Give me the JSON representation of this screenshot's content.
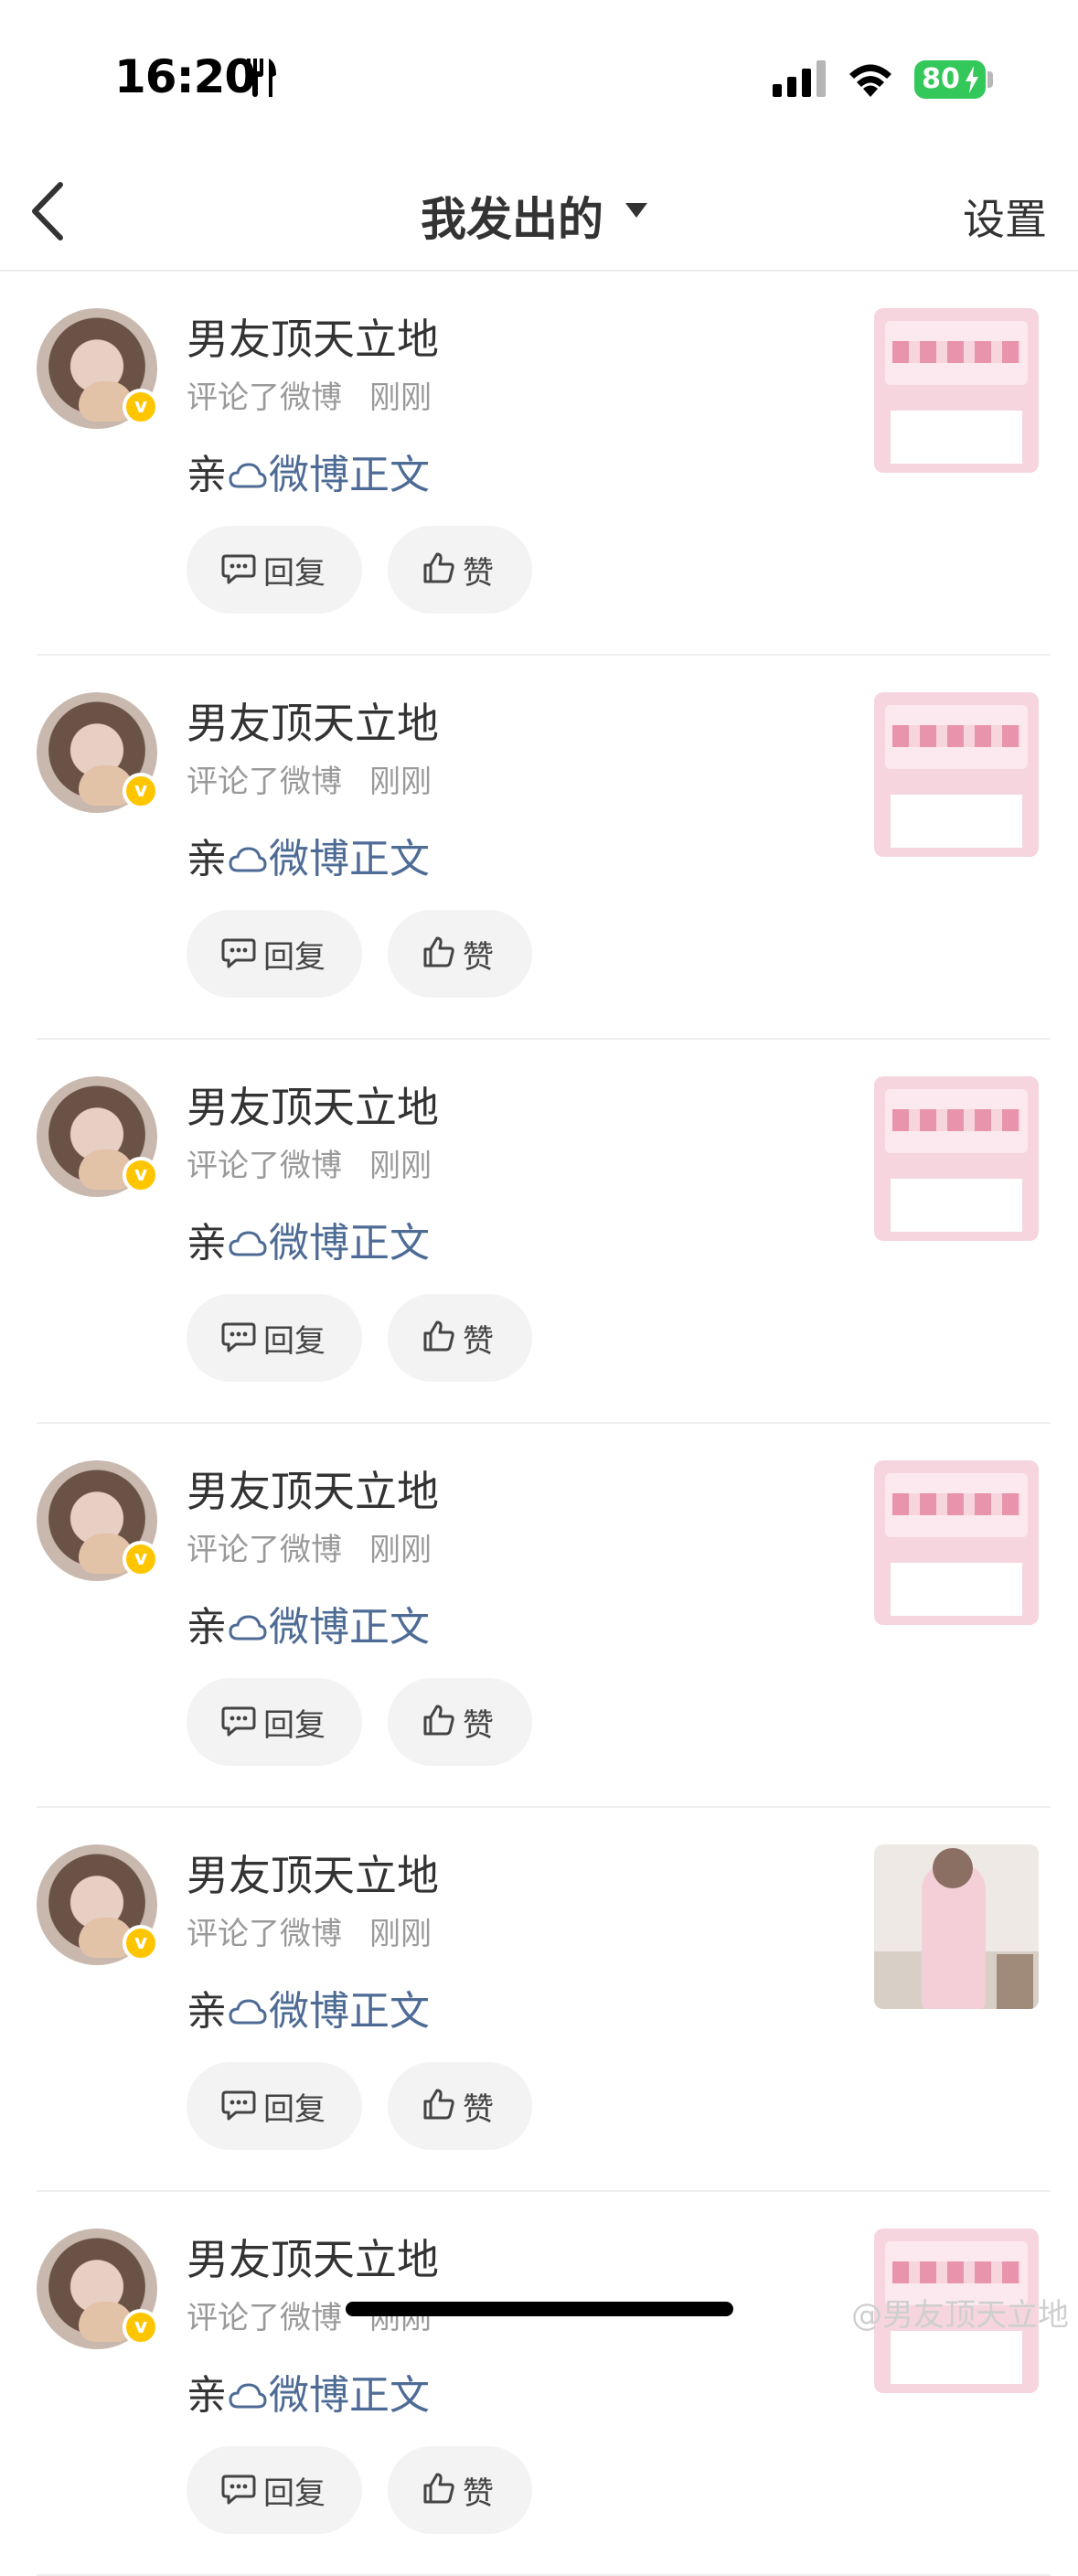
{
  "status_bar": {
    "time": "16:20",
    "battery": "80"
  },
  "nav": {
    "title": "我发出的",
    "settings": "设置"
  },
  "items": [
    {
      "name": "男友顶天立地",
      "action": "评论了微博",
      "time": "刚刚",
      "text": "亲",
      "link": "微博正文",
      "reply": "回复",
      "like": "赞",
      "thumb": "poster"
    },
    {
      "name": "男友顶天立地",
      "action": "评论了微博",
      "time": "刚刚",
      "text": "亲",
      "link": "微博正文",
      "reply": "回复",
      "like": "赞",
      "thumb": "poster"
    },
    {
      "name": "男友顶天立地",
      "action": "评论了微博",
      "time": "刚刚",
      "text": "亲",
      "link": "微博正文",
      "reply": "回复",
      "like": "赞",
      "thumb": "poster"
    },
    {
      "name": "男友顶天立地",
      "action": "评论了微博",
      "time": "刚刚",
      "text": "亲",
      "link": "微博正文",
      "reply": "回复",
      "like": "赞",
      "thumb": "poster"
    },
    {
      "name": "男友顶天立地",
      "action": "评论了微博",
      "time": "刚刚",
      "text": "亲",
      "link": "微博正文",
      "reply": "回复",
      "like": "赞",
      "thumb": "photo"
    },
    {
      "name": "男友顶天立地",
      "action": "评论了微博",
      "time": "刚刚",
      "text": "亲",
      "link": "微博正文",
      "reply": "回复",
      "like": "赞",
      "thumb": "poster"
    }
  ],
  "watermark": "@男友顶天立地",
  "colors": {
    "link": "#4e6b96",
    "badge": "#ffc600",
    "battery": "#34c759"
  }
}
